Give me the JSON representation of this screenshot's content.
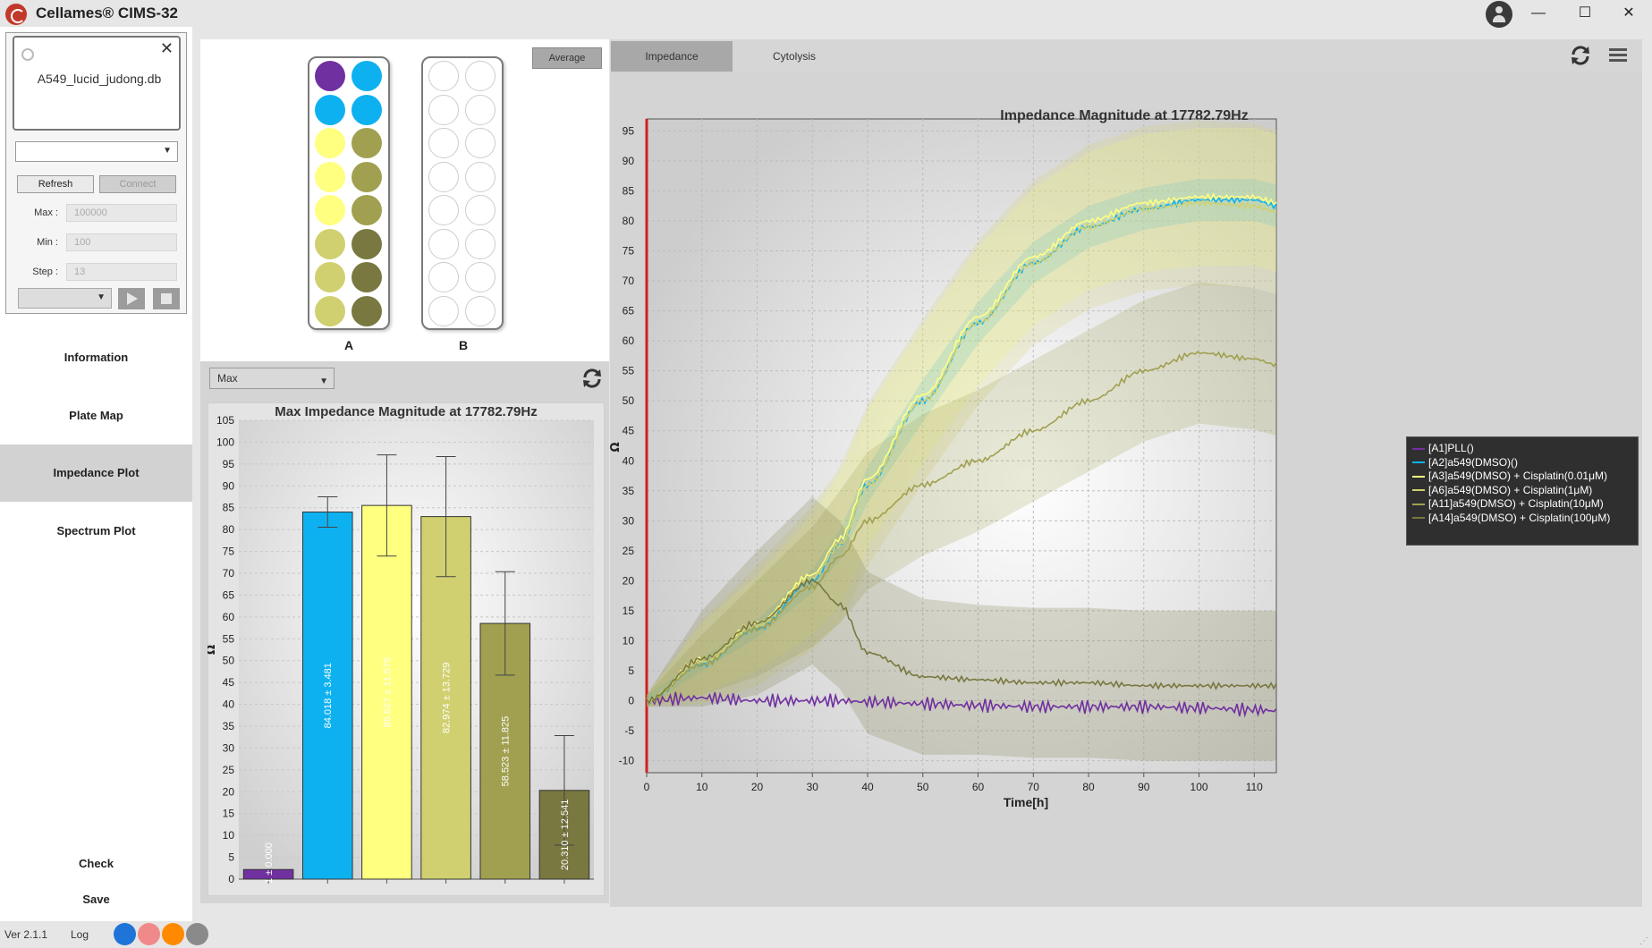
{
  "app": {
    "title": "Cellames® CIMS-32"
  },
  "window_controls": {
    "minimize": "—",
    "maximize": "☐",
    "close": "✕"
  },
  "device": {
    "db_name": "A549_lucid_judong.db",
    "refresh_label": "Refresh",
    "connect_label": "Connect",
    "max_label": "Max :",
    "max_value": "100000",
    "min_label": "Min :",
    "min_value": "100",
    "step_label": "Step :",
    "step_value": "13"
  },
  "nav": {
    "items": [
      "Information",
      "Plate Map",
      "Impedance Plot",
      "Spectrum Plot"
    ],
    "active": "Impedance Plot"
  },
  "actions": {
    "check": "Check",
    "save": "Save"
  },
  "status": {
    "version": "Ver 2.1.1",
    "log": "Log",
    "dot_colors": [
      "#1e74d8",
      "#f08a8a",
      "#ff8a00",
      "#8a8a8a"
    ]
  },
  "plate_map": {
    "average_label": "Average",
    "plates": [
      {
        "label": "A",
        "wells": [
          "#7030a0",
          "#0eb1f0",
          "#0eb1f0",
          "#0eb1f0",
          "#ffff80",
          "#a0a050",
          "#ffff80",
          "#a0a050",
          "#ffff80",
          "#a0a050",
          "#d0d070",
          "#787840",
          "#d0d070",
          "#787840",
          "#d0d070",
          "#787840"
        ]
      },
      {
        "label": "B",
        "wells": [
          "#ffffff",
          "#ffffff",
          "#ffffff",
          "#ffffff",
          "#ffffff",
          "#ffffff",
          "#ffffff",
          "#ffffff",
          "#ffffff",
          "#ffffff",
          "#ffffff",
          "#ffffff",
          "#ffffff",
          "#ffffff",
          "#ffffff",
          "#ffffff"
        ]
      }
    ]
  },
  "stat_toolbar": {
    "select_value": "Max"
  },
  "tabs": {
    "impedance": "Impedance",
    "cytolysis": "Cytolysis",
    "active": "Impedance"
  },
  "chart_data": [
    {
      "type": "bar",
      "title": "Max Impedance Magnitude at 17782.79Hz",
      "ylabel": "Ω",
      "ylim": [
        0,
        105
      ],
      "yticks": [
        0,
        5,
        10,
        15,
        20,
        25,
        30,
        35,
        40,
        45,
        50,
        55,
        60,
        65,
        70,
        75,
        80,
        85,
        90,
        95,
        100,
        105
      ],
      "grid": true,
      "values": [
        2.2,
        84.018,
        85.527,
        82.974,
        58.523,
        20.31
      ],
      "errors": [
        0.0,
        3.481,
        11.575,
        13.729,
        11.825,
        12.541
      ],
      "labels": [
        "1 ± 0.000",
        "84.018 ± 3.481",
        "85.527 ± 11.575",
        "82.974 ± 13.729",
        "58.523 ± 11.825",
        "20.310 ± 12.541"
      ],
      "colors": [
        "#7030a0",
        "#0eb1f0",
        "#ffff80",
        "#d0d070",
        "#a0a050",
        "#787840"
      ]
    },
    {
      "type": "line",
      "title": "Impedance Magnitude at 17782.79Hz",
      "xlabel": "Time[h]",
      "ylabel": "Ω",
      "xlim": [
        0,
        114
      ],
      "ylim": [
        -12,
        97
      ],
      "xticks": [
        0,
        10,
        20,
        30,
        40,
        50,
        60,
        70,
        80,
        90,
        100,
        110
      ],
      "yticks": [
        -10,
        -5,
        0,
        5,
        10,
        15,
        20,
        25,
        30,
        35,
        40,
        45,
        50,
        55,
        60,
        65,
        70,
        75,
        80,
        85,
        90,
        95
      ],
      "grid": true,
      "legend_position": "right",
      "x": [
        0,
        10,
        20,
        30,
        35,
        40,
        50,
        60,
        70,
        80,
        90,
        100,
        110,
        114
      ],
      "series": [
        {
          "name": "[A1]PLL()",
          "color": "#7030a0",
          "y": [
            0,
            0.5,
            0,
            0,
            0,
            -0.2,
            -0.5,
            -0.8,
            -1,
            -1,
            -1,
            -1.2,
            -1.5,
            -1.7
          ],
          "band": [
            0,
            0,
            0,
            0,
            0,
            0,
            0,
            0,
            0,
            0,
            0,
            0,
            0,
            0
          ]
        },
        {
          "name": "[A2]a549(DMSO)()",
          "color": "#0eb1f0",
          "y": [
            0,
            6,
            12,
            20,
            26,
            36,
            50,
            63,
            73,
            79,
            82,
            83.5,
            83.5,
            82.5
          ],
          "band": [
            1,
            1,
            1.5,
            2,
            2.5,
            3,
            3.5,
            3.5,
            3.5,
            3.5,
            3.5,
            3.5,
            3.5,
            3.5
          ]
        },
        {
          "name": "[A3]a549(DMSO) + Cisplatin(0.01μM)",
          "color": "#ffff80",
          "y": [
            0,
            7,
            13,
            21,
            27,
            37,
            51,
            64,
            74,
            80,
            83,
            84,
            84,
            83
          ],
          "band": [
            1,
            6,
            8,
            10,
            11,
            11.5,
            11.5,
            11.5,
            11.5,
            11.5,
            11.5,
            11.5,
            11.5,
            11.5
          ]
        },
        {
          "name": "[A6]a549(DMSO) + Cisplatin(1μM)",
          "color": "#d0d070",
          "y": [
            0,
            6.5,
            12.5,
            20.5,
            26,
            36,
            50,
            63,
            73,
            79,
            82,
            83,
            82.5,
            81.5
          ],
          "band": [
            1,
            7,
            10,
            12,
            13,
            13.5,
            13.7,
            13.7,
            13.7,
            13.7,
            13.7,
            13.7,
            13.7,
            13.7
          ]
        },
        {
          "name": "[A11]a549(DMSO) + Cisplatin(10μM)",
          "color": "#a0a050",
          "y": [
            0,
            6,
            12,
            19,
            24,
            30,
            36,
            40,
            45,
            50,
            55,
            58,
            57,
            56
          ],
          "band": [
            1,
            5,
            8,
            10,
            11,
            11.5,
            11.8,
            11.8,
            11.8,
            11.8,
            11.8,
            11.8,
            11.8,
            11.8
          ]
        },
        {
          "name": "[A14]a549(DMSO) + Cisplatin(100μM)",
          "color": "#787840",
          "y": [
            0,
            7,
            13,
            20,
            16,
            8,
            4,
            3.5,
            3,
            3,
            2.5,
            2.5,
            2.5,
            2.5
          ],
          "band": [
            1,
            8,
            12,
            14,
            14,
            13.5,
            13,
            12.5,
            12.5,
            12.5,
            12.5,
            12.5,
            12.5,
            12.5
          ]
        }
      ]
    }
  ]
}
